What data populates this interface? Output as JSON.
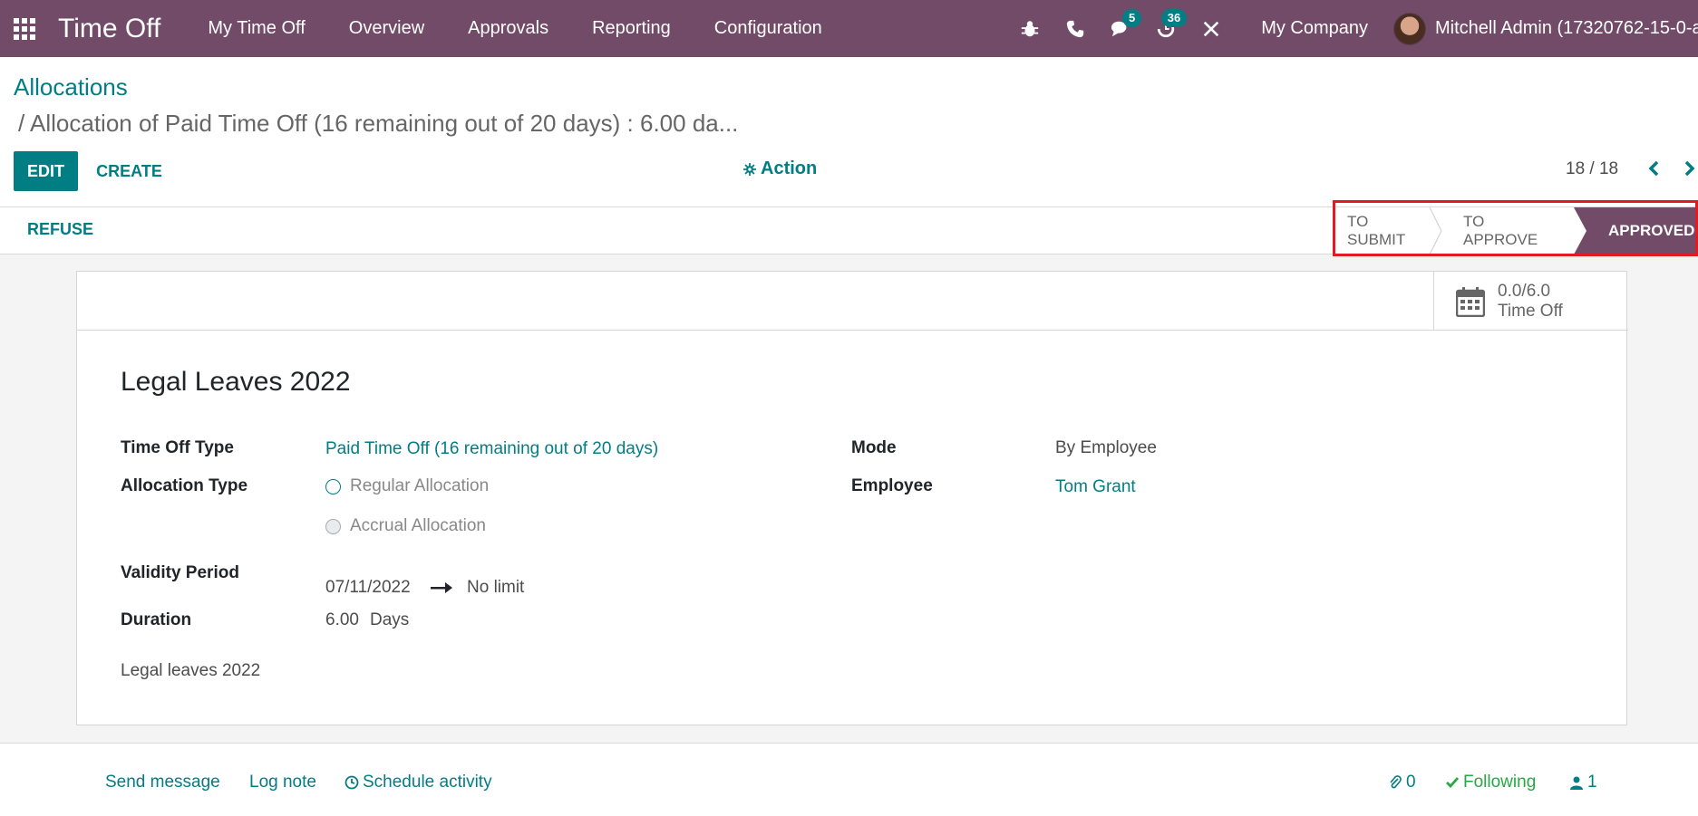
{
  "navbar": {
    "app_title": "Time Off",
    "menu": [
      "My Time Off",
      "Overview",
      "Approvals",
      "Reporting",
      "Configuration"
    ],
    "messages_count": "5",
    "activities_count": "36",
    "company": "My Company",
    "user": "Mitchell Admin (17320762-15-0-al"
  },
  "breadcrumb": {
    "parent": "Allocations",
    "current": "/ Allocation of Paid Time Off (16 remaining out of 20 days) : 6.00 da..."
  },
  "buttons": {
    "edit": "EDIT",
    "create": "CREATE",
    "action": "Action",
    "refuse": "REFUSE"
  },
  "pager": {
    "value": "18 / 18"
  },
  "stages": {
    "items": [
      "TO SUBMIT",
      "TO APPROVE",
      "APPROVED"
    ],
    "active": "APPROVED"
  },
  "stat": {
    "value": "0.0/6.0",
    "label": "Time Off"
  },
  "form": {
    "title": "Legal Leaves 2022",
    "time_off_type_label": "Time Off Type",
    "time_off_type_value": "Paid Time Off (16 remaining out of 20 days)",
    "allocation_type_label": "Allocation Type",
    "allocation_options": [
      "Regular Allocation",
      "Accrual Allocation"
    ],
    "validity_label": "Validity Period",
    "validity_start": "07/11/2022",
    "validity_end": "No limit",
    "duration_label": "Duration",
    "duration_value": "6.00",
    "duration_unit": "Days",
    "mode_label": "Mode",
    "mode_value": "By Employee",
    "employee_label": "Employee",
    "employee_value": "Tom Grant",
    "notes": "Legal leaves 2022"
  },
  "chatter": {
    "send_message": "Send message",
    "log_note": "Log note",
    "schedule_activity": "Schedule activity",
    "attachments": "0",
    "following": "Following",
    "followers": "1"
  },
  "colors": {
    "brand": "#714b67",
    "accent": "#017e84",
    "highlight": "#e01b24"
  }
}
